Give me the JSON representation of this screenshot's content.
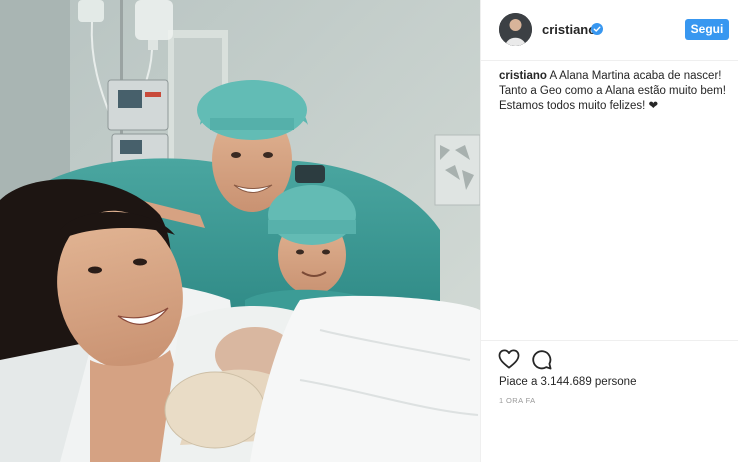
{
  "post": {
    "username": "cristiano",
    "follow_label": "Segui",
    "caption": {
      "username": "cristiano",
      "text": "A Alana Martina acaba de nascer! Tanto a Geo como a Alana estão muito bem! Estamos todos muito felizes! ❤"
    },
    "likes": "Piace a 3.144.689 persone",
    "timestamp": "1 ORA FA"
  },
  "icons": {
    "verified": "verified-badge-icon",
    "like": "heart-icon",
    "comment": "comment-icon"
  },
  "colors": {
    "accent": "#3897f0",
    "text": "#262626",
    "muted": "#999999",
    "divider": "#efefef"
  }
}
